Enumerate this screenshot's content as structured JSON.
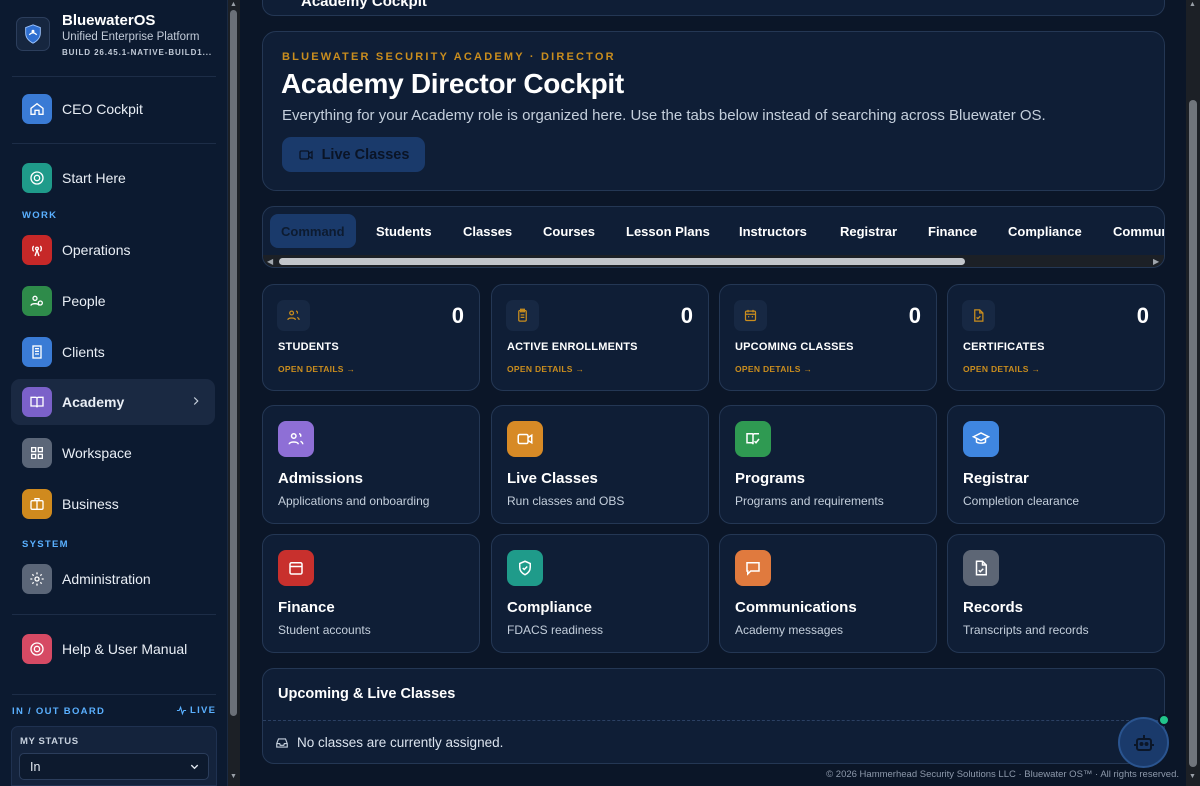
{
  "brand": {
    "title": "BluewaterOS",
    "subtitle": "Unified Enterprise Platform",
    "build": "BUILD 26.45.1-NATIVE-BUILD1..."
  },
  "sidebar": {
    "ceo": "CEO Cockpit",
    "start": "Start Here",
    "section_work": "WORK",
    "items_work": [
      {
        "label": "Operations",
        "icon": "antenna-icon",
        "color": "#c62828"
      },
      {
        "label": "People",
        "icon": "people-icon",
        "color": "#2e8b4a"
      },
      {
        "label": "Clients",
        "icon": "building-icon",
        "color": "#3a7bd5"
      },
      {
        "label": "Academy",
        "icon": "book-icon",
        "color": "#7b61c9"
      },
      {
        "label": "Workspace",
        "icon": "grid-icon",
        "color": "#5b6678"
      },
      {
        "label": "Business",
        "icon": "briefcase-icon",
        "color": "#d08a1e"
      }
    ],
    "section_system": "SYSTEM",
    "admin": "Administration",
    "help": "Help & User Manual",
    "board_title": "IN / OUT BOARD",
    "board_live": "LIVE",
    "status_label": "MY STATUS",
    "status_value": "In"
  },
  "header": {
    "stub_title": "Academy Cockpit",
    "eyebrow": "BLUEWATER SECURITY ACADEMY · DIRECTOR",
    "title": "Academy Director Cockpit",
    "description": "Everything for your Academy role is organized here. Use the tabs below instead of searching across Bluewater OS.",
    "button": "Live Classes"
  },
  "tabs": [
    "Command",
    "Students",
    "Classes",
    "Courses",
    "Lesson Plans",
    "Instructors",
    "Registrar",
    "Finance",
    "Compliance",
    "Communications"
  ],
  "stats": [
    {
      "label": "STUDENTS",
      "value": "0",
      "link": "OPEN DETAILS →",
      "icon": "users-icon"
    },
    {
      "label": "ACTIVE ENROLLMENTS",
      "value": "0",
      "link": "OPEN DETAILS →",
      "icon": "clipboard-icon"
    },
    {
      "label": "UPCOMING CLASSES",
      "value": "0",
      "link": "OPEN DETAILS →",
      "icon": "calendar-icon"
    },
    {
      "label": "CERTIFICATES",
      "value": "0",
      "link": "OPEN DETAILS →",
      "icon": "certificate-icon"
    }
  ],
  "modules": [
    {
      "title": "Admissions",
      "subtitle": "Applications and onboarding",
      "icon": "users-icon",
      "color": "#8e6fd6"
    },
    {
      "title": "Live Classes",
      "subtitle": "Run classes and OBS",
      "icon": "video-icon",
      "color": "#d78a26"
    },
    {
      "title": "Programs",
      "subtitle": "Programs and requirements",
      "icon": "book-check-icon",
      "color": "#2f9a52"
    },
    {
      "title": "Registrar",
      "subtitle": "Completion clearance",
      "icon": "graduation-cap-icon",
      "color": "#3f86e0"
    },
    {
      "title": "Finance",
      "subtitle": "Student accounts",
      "icon": "wallet-icon",
      "color": "#c8302d"
    },
    {
      "title": "Compliance",
      "subtitle": "FDACS readiness",
      "icon": "shield-check-icon",
      "color": "#1f9b8a"
    },
    {
      "title": "Communications",
      "subtitle": "Academy messages",
      "icon": "message-icon",
      "color": "#e07a3e"
    },
    {
      "title": "Records",
      "subtitle": "Transcripts and records",
      "icon": "file-icon",
      "color": "#5d6675"
    }
  ],
  "upcoming": {
    "title": "Upcoming & Live Classes",
    "empty": "No classes are currently assigned."
  },
  "footer": "© 2026 Hammerhead Security Solutions LLC · Bluewater OS™ · All rights reserved."
}
